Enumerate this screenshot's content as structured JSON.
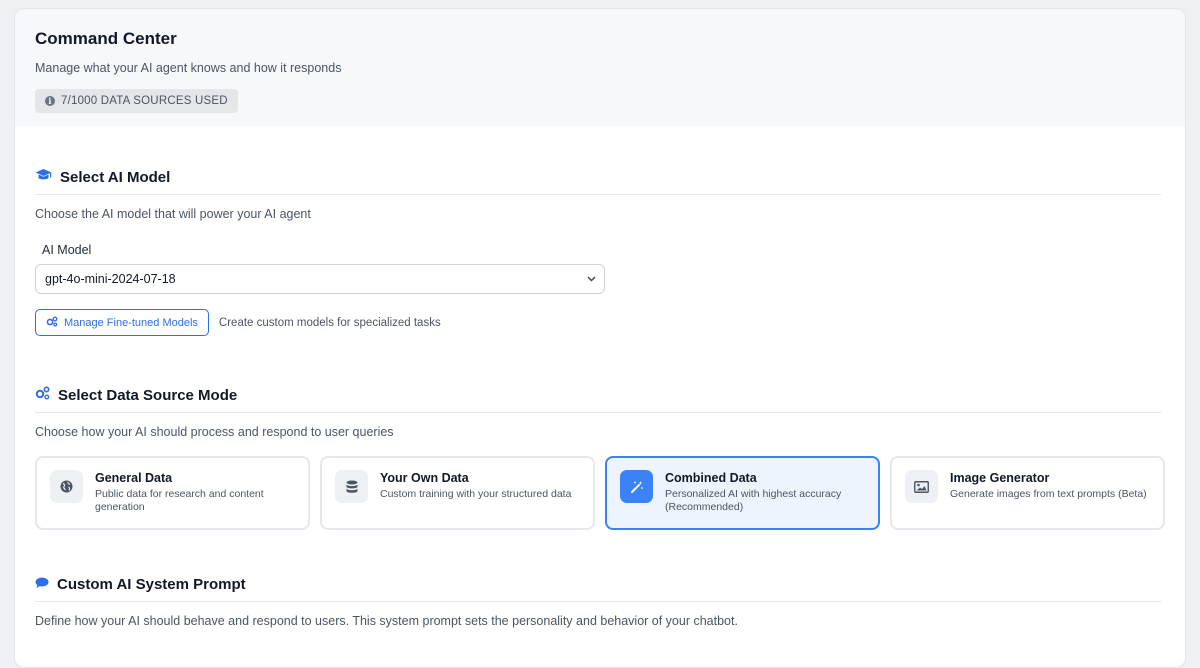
{
  "header": {
    "title": "Command Center",
    "subtitle": "Manage what your AI agent knows and how it responds",
    "usage_badge": "7/1000 DATA SOURCES USED"
  },
  "model_section": {
    "title": "Select AI Model",
    "description": "Choose the AI model that will power your AI agent",
    "field_label": "AI Model",
    "selected_model": "gpt-4o-mini-2024-07-18",
    "fine_tune_button": "Manage Fine-tuned Models",
    "fine_tune_description": "Create custom models for specialized tasks"
  },
  "mode_section": {
    "title": "Select Data Source Mode",
    "description": "Choose how your AI should process and respond to user queries",
    "cards": [
      {
        "title": "General Data",
        "description": "Public data for research and content generation",
        "icon": "globe-icon",
        "selected": false
      },
      {
        "title": "Your Own Data",
        "description": "Custom training with your structured data",
        "icon": "database-icon",
        "selected": false
      },
      {
        "title": "Combined Data",
        "description": "Personalized AI with highest accuracy (Recommended)",
        "icon": "magic-wand-icon",
        "selected": true
      },
      {
        "title": "Image Generator",
        "description": "Generate images from text prompts (Beta)",
        "icon": "image-icon",
        "selected": false
      }
    ]
  },
  "prompt_section": {
    "title": "Custom AI System Prompt",
    "description": "Define how your AI should behave and respond to users. This system prompt sets the personality and behavior of your chatbot."
  },
  "colors": {
    "accent": "#2f6fe4",
    "selected_card_bg": "#eef4fe",
    "selected_card_border": "#3b82f6"
  }
}
